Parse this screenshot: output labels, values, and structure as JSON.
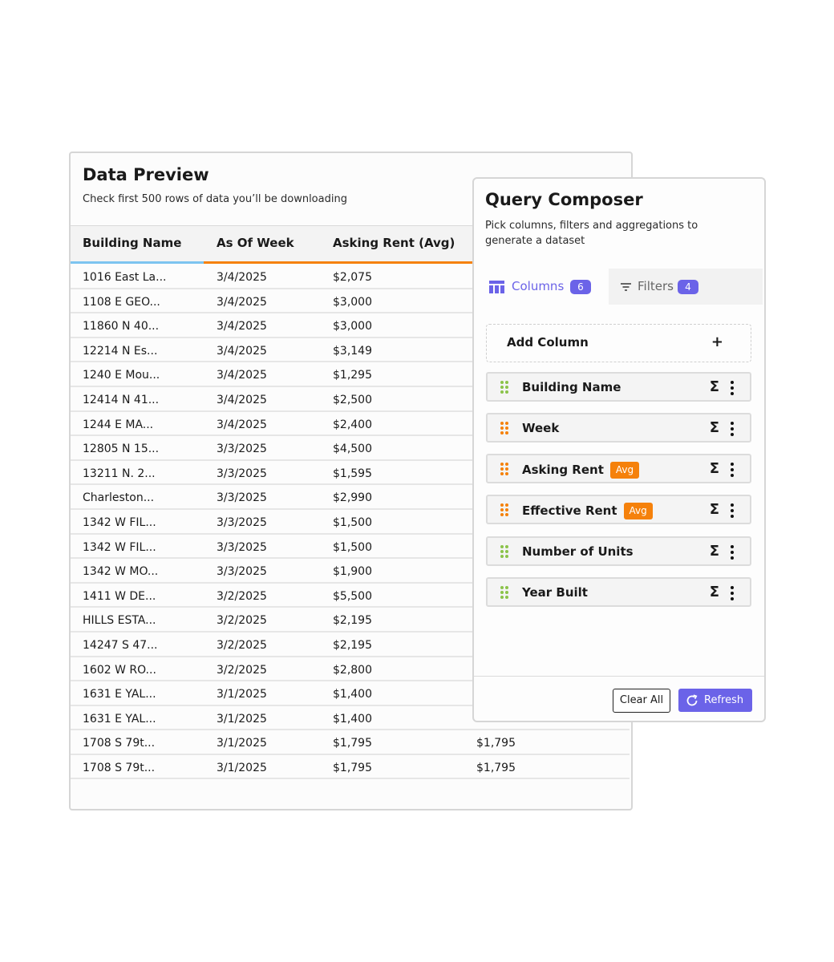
{
  "preview": {
    "title": "Data Preview",
    "subtitle": "Check first 500 rows of data you’ll be downloading",
    "columns": [
      "Building Name",
      "As Of Week",
      "Asking Rent (Avg)"
    ],
    "rows": [
      [
        "1016 East La...",
        "3/4/2025",
        "$2,075",
        ""
      ],
      [
        "1108 E GEO...",
        "3/4/2025",
        "$3,000",
        ""
      ],
      [
        "11860 N 40...",
        "3/4/2025",
        "$3,000",
        ""
      ],
      [
        "12214 N Es...",
        "3/4/2025",
        "$3,149",
        ""
      ],
      [
        "1240 E Mou...",
        "3/4/2025",
        "$1,295",
        ""
      ],
      [
        "12414 N 41...",
        "3/4/2025",
        "$2,500",
        ""
      ],
      [
        "1244 E MA...",
        "3/4/2025",
        "$2,400",
        ""
      ],
      [
        "12805 N 15...",
        "3/3/2025",
        "$4,500",
        ""
      ],
      [
        "13211 N. 2...",
        "3/3/2025",
        "$1,595",
        ""
      ],
      [
        "Charleston...",
        "3/3/2025",
        "$2,990",
        ""
      ],
      [
        "1342 W FIL...",
        "3/3/2025",
        "$1,500",
        ""
      ],
      [
        "1342 W FIL...",
        "3/3/2025",
        "$1,500",
        ""
      ],
      [
        "1342 W MO...",
        "3/3/2025",
        "$1,900",
        ""
      ],
      [
        "1411 W DE...",
        "3/2/2025",
        "$5,500",
        ""
      ],
      [
        "HILLS ESTA...",
        "3/2/2025",
        "$2,195",
        ""
      ],
      [
        "14247 S 47...",
        "3/2/2025",
        "$2,195",
        ""
      ],
      [
        "1602 W RO...",
        "3/2/2025",
        "$2,800",
        ""
      ],
      [
        "1631 E YAL...",
        "3/1/2025",
        "$1,400",
        ""
      ],
      [
        "1631 E YAL...",
        "3/1/2025",
        "$1,400",
        ""
      ],
      [
        "1708 S 79t...",
        "3/1/2025",
        "$1,795",
        "$1,795"
      ],
      [
        "1708 S 79t...",
        "3/1/2025",
        "$1,795",
        "$1,795"
      ]
    ],
    "header_accents": [
      "#7cc4f0",
      "#f5810b",
      "#f5810b"
    ]
  },
  "composer": {
    "title": "Query Composer",
    "subtitle": "Pick columns, filters and aggregations to generate a dataset",
    "tabs": {
      "columns": {
        "label": "Columns",
        "count": "6",
        "icon": "table-icon"
      },
      "filters": {
        "label": "Filters",
        "count": "4",
        "icon": "filter-icon"
      }
    },
    "add_column": {
      "label": "Add Column",
      "plus": "+"
    },
    "items": [
      {
        "label": "Building Name",
        "badge": "",
        "dot_color": "#8bc34a"
      },
      {
        "label": "Week",
        "badge": "",
        "dot_color": "#f5810b"
      },
      {
        "label": "Asking Rent",
        "badge": "Avg",
        "dot_color": "#f5810b"
      },
      {
        "label": "Effective Rent",
        "badge": "Avg",
        "dot_color": "#f5810b"
      },
      {
        "label": "Number of Units",
        "badge": "",
        "dot_color": "#8bc34a"
      },
      {
        "label": "Year Built",
        "badge": "",
        "dot_color": "#8bc34a"
      }
    ],
    "sigma_symbol": "Σ",
    "buttons": {
      "clear": "Clear All",
      "refresh": "Refresh"
    },
    "accent": "#6b63e8",
    "aggregation_color": "#f5810b"
  }
}
